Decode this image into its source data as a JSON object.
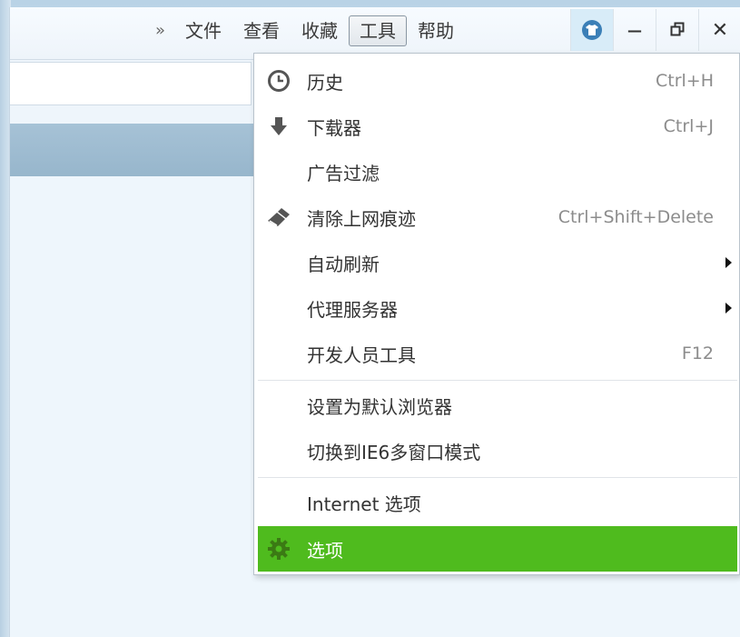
{
  "menubar": {
    "overflow": "»",
    "items": [
      {
        "label": "文件"
      },
      {
        "label": "查看"
      },
      {
        "label": "收藏"
      },
      {
        "label": "工具"
      },
      {
        "label": "帮助"
      }
    ]
  },
  "window_controls": {
    "minimize": "—",
    "restore": "🗗",
    "close": "✕"
  },
  "tools_menu": {
    "items": [
      {
        "icon": "clock-icon",
        "label": "历史",
        "shortcut": "Ctrl+H"
      },
      {
        "icon": "download-arrow-icon",
        "label": "下载器",
        "shortcut": "Ctrl+J"
      },
      {
        "icon": "",
        "label": "广告过滤",
        "shortcut": ""
      },
      {
        "icon": "broom-icon",
        "label": "清除上网痕迹",
        "shortcut": "Ctrl+Shift+Delete"
      },
      {
        "icon": "",
        "label": "自动刷新",
        "shortcut": "",
        "submenu": true
      },
      {
        "icon": "",
        "label": "代理服务器",
        "shortcut": "",
        "submenu": true
      },
      {
        "icon": "",
        "label": "开发人员工具",
        "shortcut": "F12"
      },
      {
        "icon": "",
        "label": "设置为默认浏览器",
        "shortcut": ""
      },
      {
        "icon": "",
        "label": "切换到IE6多窗口模式",
        "shortcut": ""
      },
      {
        "icon": "",
        "label": "Internet 选项",
        "shortcut": ""
      },
      {
        "icon": "gear-icon",
        "label": "选项",
        "shortcut": "",
        "highlighted": true
      }
    ],
    "highlight_color": "#4fbb1e"
  }
}
